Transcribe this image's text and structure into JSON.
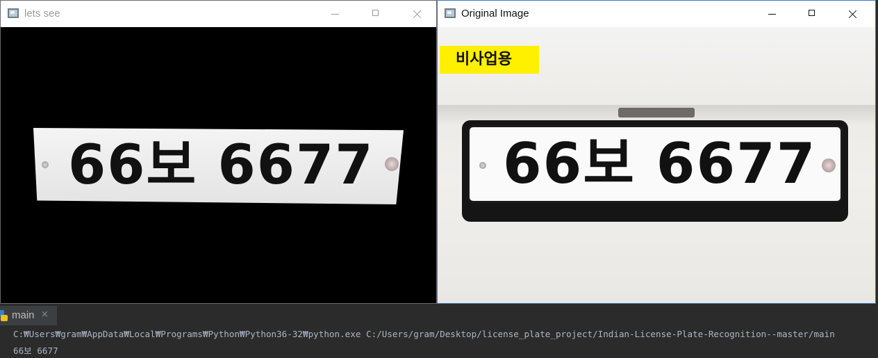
{
  "windows": [
    {
      "title": "lets see",
      "plate_text": "66보 6677"
    },
    {
      "title": "Original Image",
      "badge_text": "비사업용",
      "plate_text": "66보 6677"
    }
  ],
  "run_panel": {
    "tab_label": "main",
    "close_glyph": "×",
    "command": "C:₩Users₩gram₩AppData₩Local₩Programs₩Python₩Python36-32₩python.exe C:/Users/gram/Desktop/license_plate_project/Indian-License-Plate-Recognition--master/main",
    "output": "66보 6677"
  },
  "colors": {
    "badge_yellow": "#fff000",
    "console_bg": "#2b2b2b",
    "active_border": "#3a79c9"
  },
  "icons": [
    "opencv-window-icon",
    "minimize-icon",
    "maximize-icon",
    "close-icon",
    "python-icon"
  ]
}
